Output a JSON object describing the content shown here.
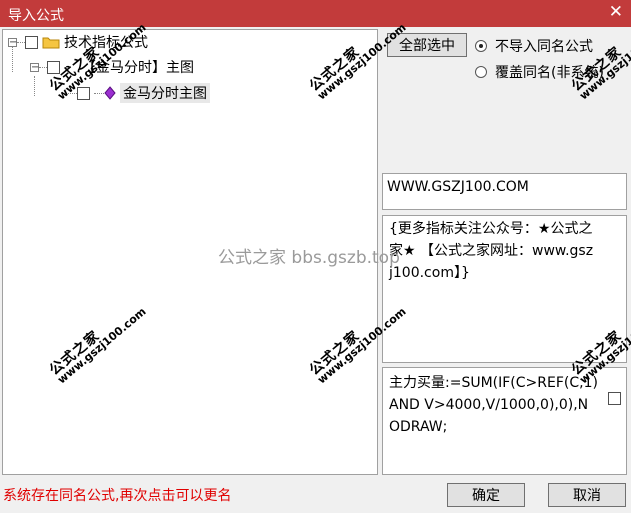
{
  "window": {
    "title": "导入公式",
    "close_glyph": "✕"
  },
  "tree": {
    "root": {
      "label": "技术指标公式",
      "expander": "⊟"
    },
    "group": {
      "label": "【金马分时】主图",
      "expander": "⊟"
    },
    "leaf": {
      "label": "金马分时主图"
    }
  },
  "select_all_label": "全部选中",
  "options": [
    {
      "label": "不导入同名公式",
      "selected": true
    },
    {
      "label": "覆盖同名(非系统)",
      "selected": false
    }
  ],
  "url_box": "WWW.GSZJ100.COM",
  "description_box": "{更多指标关注公众号：★公式之家★ 【公式之家网址：www.gszj100.com】}",
  "formula_box": "主力买量:=SUM(IF(C>REF(C,1) AND V>4000,V/1000,0),0),NODRAW;",
  "status_text": "系统存在同名公式,再次点击可以更名",
  "buttons": {
    "ok": "确定",
    "cancel": "取消"
  },
  "watermark": {
    "site": "公式之家 bbs.gszb.top",
    "brand": "公式之家",
    "url": "www.gszj100.com"
  },
  "colors": {
    "titlebar": "#c23b3b",
    "status": "#e00000",
    "folder": "#f5c542",
    "leaf_icon": "#9b2fd1"
  }
}
